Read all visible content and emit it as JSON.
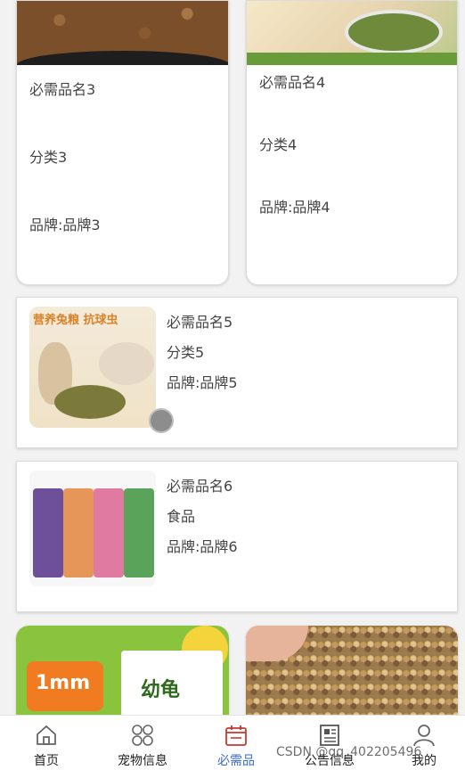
{
  "products": [
    {
      "name": "必需品名3",
      "category": "分类3",
      "brand": "品牌:品牌3"
    },
    {
      "name": "必需品名4",
      "category": "分类4",
      "brand": "品牌:品牌4"
    },
    {
      "name": "必需品名5",
      "category": "分类5",
      "brand": "品牌:品牌5",
      "image_title": "营养兔粮 抗球虫"
    },
    {
      "name": "必需品名6",
      "category": "食品",
      "brand": "品牌:品牌6"
    }
  ],
  "bottom_cards": [
    {
      "badge_text": "1mm",
      "box_text": "幼龟"
    },
    {}
  ],
  "tabbar": {
    "items": [
      {
        "label": "首页",
        "icon": "home-icon"
      },
      {
        "label": "宠物信息",
        "icon": "grid-icon"
      },
      {
        "label": "必需品",
        "icon": "calendar-icon",
        "active": true
      },
      {
        "label": "公告信息",
        "icon": "news-icon"
      },
      {
        "label": "我的",
        "icon": "user-icon"
      }
    ],
    "active_color": "#3a6bc9"
  },
  "watermark": "CSDN @qq_40220549­6"
}
